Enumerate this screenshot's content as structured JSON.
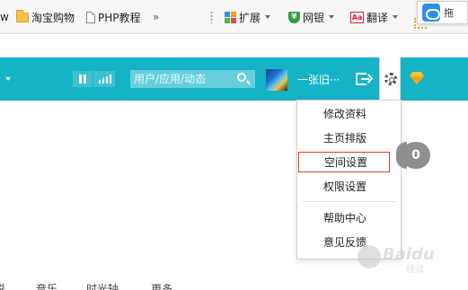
{
  "bookmarks_bar": {
    "partial_left": "w",
    "items": [
      {
        "label": "淘宝购物",
        "icon": "folder-icon"
      },
      {
        "label": "PHP教程",
        "icon": "page-icon"
      }
    ],
    "overflow": "»",
    "extensions": [
      {
        "label": "扩展",
        "icon": "grid-icon"
      },
      {
        "label": "网银",
        "icon": "shield-icon",
        "icon_glyph": "¥"
      },
      {
        "label": "翻译",
        "icon": "translate-icon",
        "icon_glyph": "Aa"
      }
    ],
    "tooltip": {
      "label": "拖"
    }
  },
  "navbar": {
    "color": "#15b3c6",
    "search": {
      "placeholder": "用户/应用/动态"
    },
    "user": {
      "name": "一张旧···"
    }
  },
  "dropdown": {
    "items": [
      {
        "label": "修改资料"
      },
      {
        "label": "主页排版"
      },
      {
        "label": "空间设置",
        "highlighted": true,
        "highlight_color": "#e0392b"
      },
      {
        "label": "权限设置"
      },
      {
        "label": "帮助中心"
      },
      {
        "label": "意见反馈"
      }
    ]
  },
  "content": {
    "badge_count": "0",
    "bottom_tabs": [
      "说",
      "音乐",
      "时光轴",
      "更多"
    ]
  },
  "watermark": {
    "text": "Baidu",
    "sub": "经验"
  }
}
